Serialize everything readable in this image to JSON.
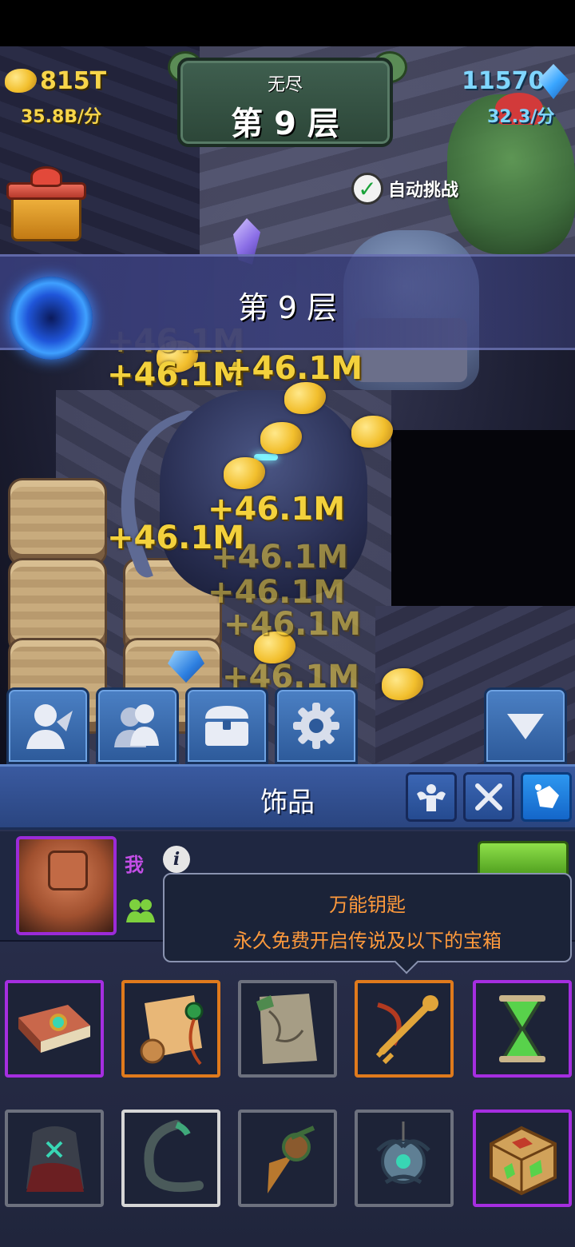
{
  "hud": {
    "gold_amount": "815T",
    "gold_rate": "35.8B/分",
    "gem_amount": "11570",
    "gem_rate": "32.3/分",
    "mode_label": "无尽",
    "floor_title": "第 9 层",
    "auto_battle": "自动挑战",
    "floor_bar": "第 9 层"
  },
  "floating_numbers": [
    "+46.1M",
    "+46.1M",
    "+46.1M",
    "+46.1M",
    "+46.1M",
    "+46.1M",
    "+46.1M",
    "+46.1M",
    "+46.1M",
    "+46.1M"
  ],
  "tabs": [
    {
      "icon": "hero-icon"
    },
    {
      "icon": "team-icon"
    },
    {
      "icon": "chest-icon"
    },
    {
      "icon": "gear-icon"
    },
    {
      "icon": "collapse-arrow-icon"
    }
  ],
  "panel": {
    "title": "饰品",
    "sub_tabs": [
      {
        "icon": "strength-icon"
      },
      {
        "icon": "swords-icon"
      },
      {
        "icon": "gems-icon",
        "active": true
      }
    ]
  },
  "profile": {
    "name": "我",
    "info_icon": "i"
  },
  "tooltip": {
    "title": "万能钥匙",
    "desc": "永久免费开启传说及以下的宝箱"
  },
  "items": [
    {
      "icon": "spellbook-icon",
      "rarity": "epic"
    },
    {
      "icon": "scroll-icon",
      "rarity": "legend"
    },
    {
      "icon": "map-icon",
      "rarity": "gray"
    },
    {
      "icon": "master-key-icon",
      "rarity": "legend"
    },
    {
      "icon": "hourglass-icon",
      "rarity": "epic"
    },
    {
      "icon": "rune-stone-icon",
      "rarity": "gray"
    },
    {
      "icon": "claw-tail-icon",
      "rarity": "white"
    },
    {
      "icon": "drill-icon",
      "rarity": "gray"
    },
    {
      "icon": "amulet-icon",
      "rarity": "gray"
    },
    {
      "icon": "rune-cube-icon",
      "rarity": "epic"
    }
  ],
  "colors": {
    "gold_text": "#f7d54a",
    "gem_text": "#7fd6ff",
    "float_text": "#f3d13c",
    "tooltip_text": "#ff9a3c",
    "player_name": "#c34ee6",
    "epic_border": "#a52ee0",
    "legend_border": "#e07a1c"
  }
}
